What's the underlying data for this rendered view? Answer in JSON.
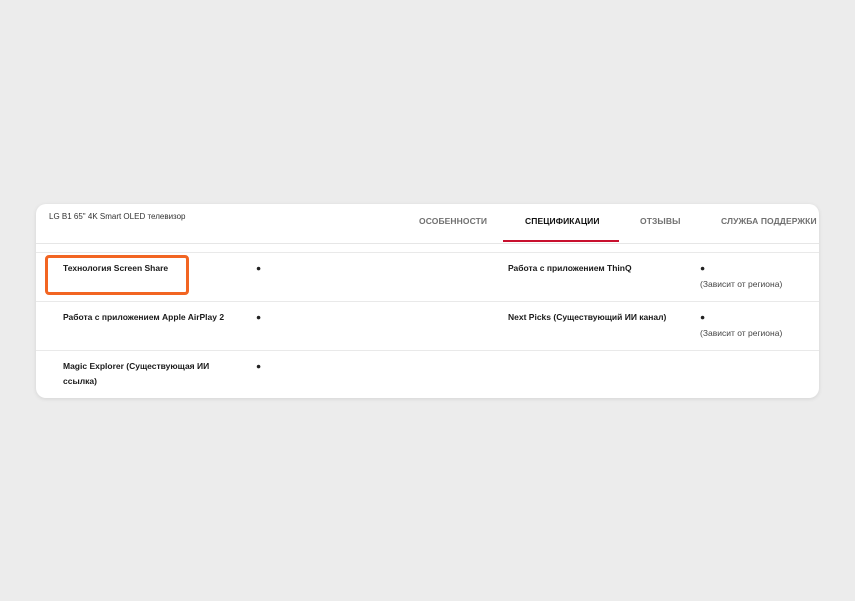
{
  "product": {
    "title": "LG B1 65\" 4K Smart OLED телевизор"
  },
  "tabs": [
    {
      "label": "ОСОБЕННОСТИ",
      "active": false
    },
    {
      "label": "СПЕЦИФИКАЦИИ",
      "active": true
    },
    {
      "label": "ОТЗЫВЫ",
      "active": false
    },
    {
      "label": "СЛУЖБА ПОДДЕРЖКИ",
      "active": false
    }
  ],
  "colors": {
    "active_tab_underline": "#c8102e",
    "highlight_border": "#f26522"
  },
  "specs": {
    "screen_share": {
      "label": "Технология Screen Share",
      "value": "●",
      "highlighted": true
    },
    "thinq": {
      "label": "Работа с приложением ThinQ",
      "value": "●",
      "note": "(Зависит от региона)"
    },
    "airplay": {
      "label": "Работа с приложением Apple AirPlay 2",
      "value": "●"
    },
    "next_picks": {
      "label": "Next Picks (Существующий ИИ канал)",
      "value": "●",
      "note": "(Зависит от региона)"
    },
    "magic_explorer": {
      "label": "Magic Explorer (Существующая ИИ ссылка)",
      "value": "●"
    }
  }
}
